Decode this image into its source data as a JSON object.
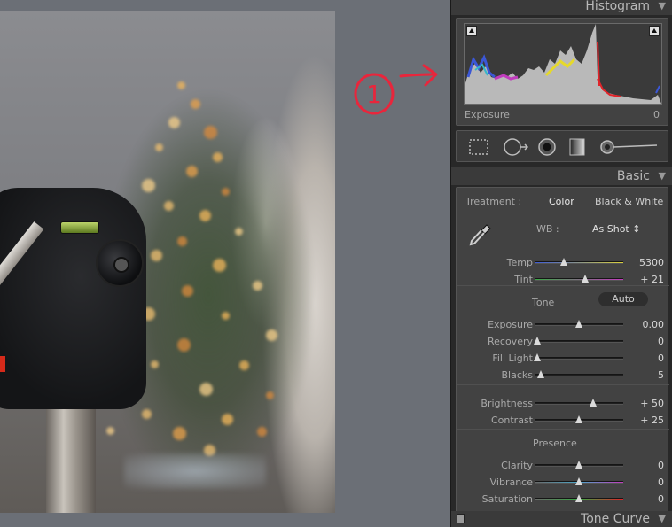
{
  "histogram": {
    "title": "Histogram",
    "exposure_label": "Exposure",
    "exposure_value": "0"
  },
  "basic": {
    "title": "Basic",
    "treatment_label": "Treatment :",
    "treatment_color": "Color",
    "treatment_bw": "Black & White",
    "wb_label": "WB :",
    "wb_value": "As Shot ↕",
    "tone_label": "Tone",
    "auto_label": "Auto",
    "presence_label": "Presence",
    "sliders": [
      {
        "label": "Temp",
        "value": "5300",
        "pos": 0.33,
        "track": "temp"
      },
      {
        "label": "Tint",
        "value": "+ 21",
        "pos": 0.57,
        "track": "tint"
      },
      {
        "label": "Exposure",
        "value": "0.00",
        "pos": 0.5,
        "track": "plain"
      },
      {
        "label": "Recovery",
        "value": "0",
        "pos": 0.03,
        "track": "plain"
      },
      {
        "label": "Fill Light",
        "value": "0",
        "pos": 0.03,
        "track": "plain"
      },
      {
        "label": "Blacks",
        "value": "5",
        "pos": 0.07,
        "track": "plain"
      },
      {
        "label": "Brightness",
        "value": "+ 50",
        "pos": 0.66,
        "track": "plain"
      },
      {
        "label": "Contrast",
        "value": "+ 25",
        "pos": 0.5,
        "track": "plain"
      },
      {
        "label": "Clarity",
        "value": "0",
        "pos": 0.5,
        "track": "plain"
      },
      {
        "label": "Vibrance",
        "value": "0",
        "pos": 0.5,
        "track": "vib"
      },
      {
        "label": "Saturation",
        "value": "0",
        "pos": 0.5,
        "track": "sat"
      }
    ]
  },
  "tone_curve": {
    "title": "Tone Curve"
  },
  "annotation": {
    "number": "1"
  },
  "colors": {
    "panel_bg": "#282828",
    "section_bg": "#424242",
    "annotation_red": "#e8263c"
  },
  "icons": {
    "panel_toggle": "triangle-down-icon",
    "crop": "crop-overlay-icon",
    "spot": "spot-removal-icon",
    "redeye": "red-eye-icon",
    "grad": "graduated-filter-icon",
    "brush": "adjustment-brush-icon"
  }
}
